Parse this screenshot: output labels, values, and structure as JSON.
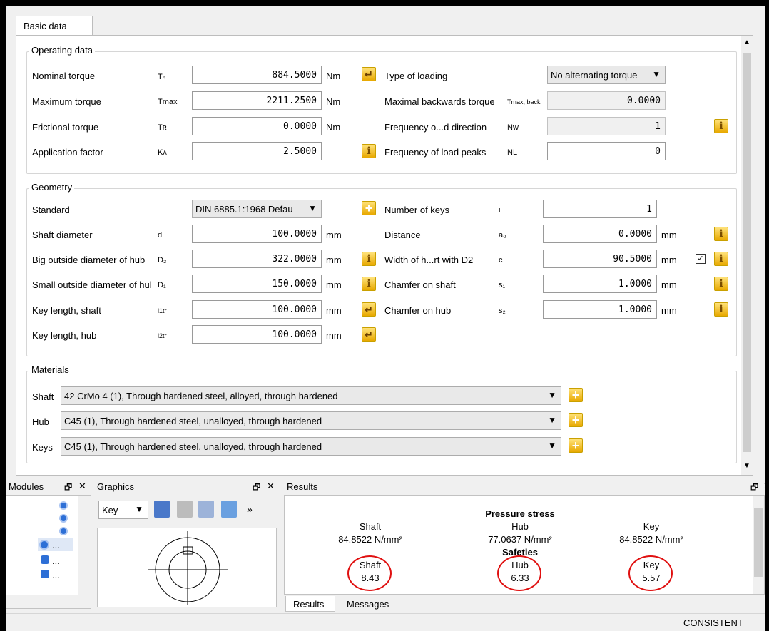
{
  "tabs": {
    "basic_data": "Basic data"
  },
  "operating": {
    "title": "Operating data",
    "nominal_torque": {
      "label": "Nominal torque",
      "sym": "Tₙ",
      "value": "884.5000",
      "unit": "Nm"
    },
    "maximum_torque": {
      "label": "Maximum torque",
      "sym": "Tmax",
      "value": "2211.2500",
      "unit": "Nm"
    },
    "frictional_torque": {
      "label": "Frictional torque",
      "sym": "Tʀ",
      "value": "0.0000",
      "unit": "Nm"
    },
    "application_factor": {
      "label": "Application factor",
      "sym": "Kᴀ",
      "value": "2.5000"
    },
    "type_of_loading": {
      "label": "Type of loading",
      "value": "No alternating torque"
    },
    "maximal_backwards": {
      "label": "Maximal backwards torque",
      "sym": "Tmax, back",
      "value": "0.0000"
    },
    "frequency_direction": {
      "label": "Frequency o...d direction",
      "sym": "Nw",
      "value": "1"
    },
    "frequency_peaks": {
      "label": "Frequency of load peaks",
      "sym": "NL",
      "value": "0"
    }
  },
  "geometry": {
    "title": "Geometry",
    "standard": {
      "label": "Standard",
      "value": "DIN 6885.1:1968 Defau"
    },
    "shaft_diameter": {
      "label": "Shaft diameter",
      "sym": "d",
      "value": "100.0000",
      "unit": "mm"
    },
    "big_outside": {
      "label": "Big outside diameter of hub",
      "sym": "D₂",
      "value": "322.0000",
      "unit": "mm"
    },
    "small_outside": {
      "label": "Small outside diameter of hul",
      "sym": "D₁",
      "value": "150.0000",
      "unit": "mm"
    },
    "key_length_shaft": {
      "label": "Key length, shaft",
      "sym": "l1tr",
      "value": "100.0000",
      "unit": "mm"
    },
    "key_length_hub": {
      "label": "Key length, hub",
      "sym": "l2tr",
      "value": "100.0000",
      "unit": "mm"
    },
    "number_of_keys": {
      "label": "Number of keys",
      "sym": "i",
      "value": "1"
    },
    "distance": {
      "label": "Distance",
      "sym": "a₀",
      "value": "0.0000",
      "unit": "mm"
    },
    "width_of_hub": {
      "label": "Width of h...rt with D2",
      "sym": "c",
      "value": "90.5000",
      "unit": "mm"
    },
    "chamfer_shaft": {
      "label": "Chamfer on shaft",
      "sym": "s₁",
      "value": "1.0000",
      "unit": "mm"
    },
    "chamfer_hub": {
      "label": "Chamfer on hub",
      "sym": "s₂",
      "value": "1.0000",
      "unit": "mm"
    }
  },
  "materials": {
    "title": "Materials",
    "shaft": {
      "label": "Shaft",
      "value": "42 CrMo 4 (1), Through hardened steel, alloyed, through hardened"
    },
    "hub": {
      "label": "Hub",
      "value": "C45 (1), Through hardened steel, unalloyed, through hardened"
    },
    "keys": {
      "label": "Keys",
      "value": "C45 (1), Through hardened steel, unalloyed, through hardened"
    }
  },
  "panels": {
    "modules": "Modules",
    "graphics": "Graphics",
    "graphics_combo": "Key",
    "results": "Results",
    "tab_results": "Results",
    "tab_messages": "Messages"
  },
  "results": {
    "pressure_title": "Pressure stress",
    "shaft_label": "Shaft",
    "hub_label": "Hub",
    "key_label": "Key",
    "shaft_pressure": "84.8522 N/mm²",
    "hub_pressure": "77.0637 N/mm²",
    "key_pressure": "84.8522 N/mm²",
    "safeties_title": "Safeties",
    "shaft_safety": "8.43",
    "hub_safety": "6.33",
    "key_safety": "5.57"
  },
  "status": {
    "text": "CONSISTENT"
  },
  "glyphs": {
    "dock": "🗗",
    "close": "✕",
    "arrow": "▼",
    "more": "»",
    "ellipsis": "..."
  }
}
